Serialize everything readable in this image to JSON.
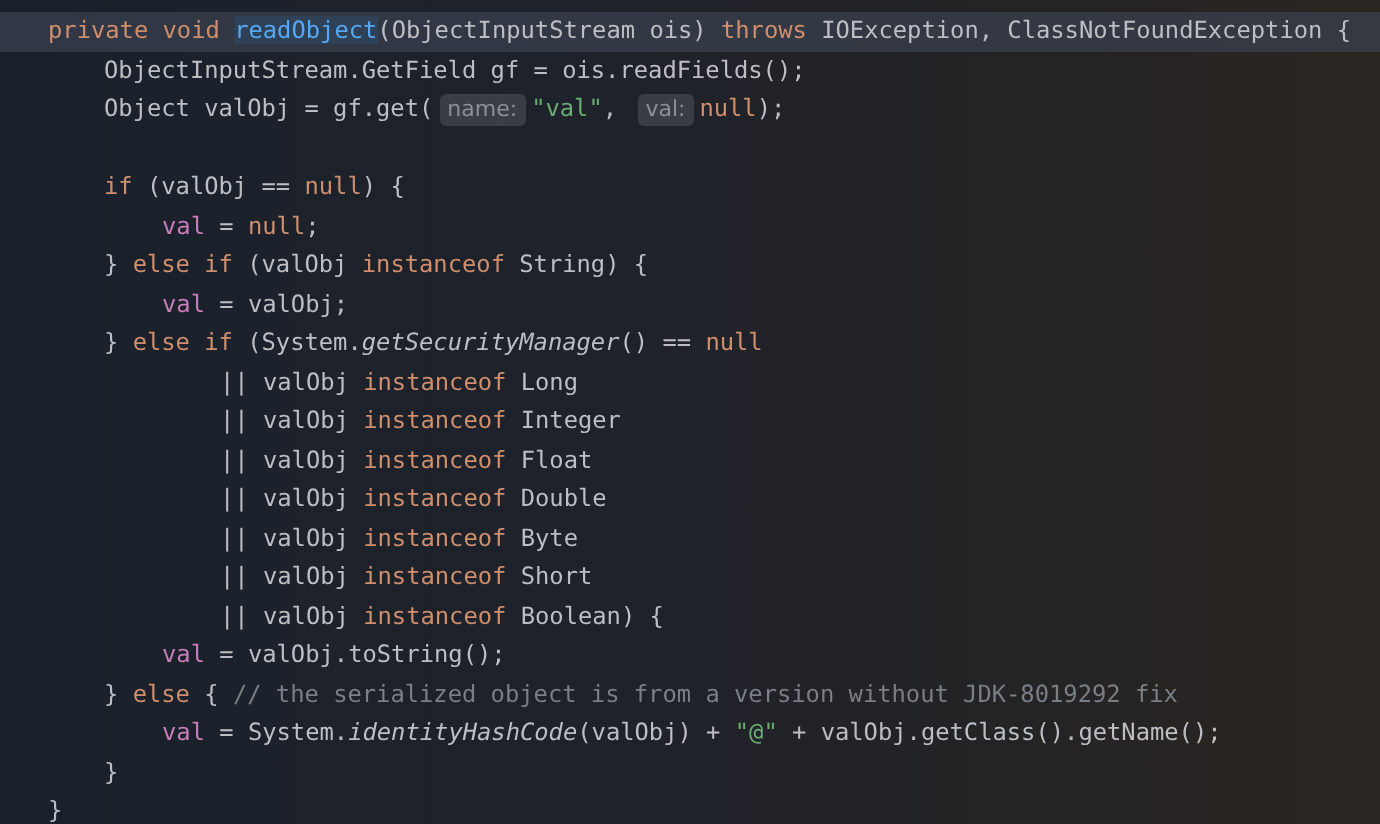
{
  "lines": [
    {
      "current": true,
      "kind": "outer",
      "tokens": [
        {
          "kind": "keyword",
          "text": "private void "
        },
        {
          "kind": "declaration",
          "text": "readObject"
        },
        {
          "kind": "plain",
          "text": "(ObjectInputStream ois) "
        },
        {
          "kind": "keyword",
          "text": "throws "
        },
        {
          "kind": "plain",
          "text": "IOException, ClassNotFoundException {"
        }
      ]
    },
    {
      "current": false,
      "kind": "body",
      "tokens": [
        {
          "kind": "plain",
          "text": "ObjectInputStream.GetField gf = ois.readFields();"
        }
      ]
    },
    {
      "current": false,
      "kind": "body",
      "tokens": [
        {
          "kind": "plain",
          "text": "Object valObj = gf.get("
        },
        {
          "kind": "hint",
          "text": "name:"
        },
        {
          "kind": "string",
          "text": "\"val\""
        },
        {
          "kind": "plain",
          "text": ", "
        },
        {
          "kind": "hint",
          "text": "val:"
        },
        {
          "kind": "keyword",
          "text": "null"
        },
        {
          "kind": "plain",
          "text": ");"
        }
      ]
    },
    {
      "current": false,
      "kind": "blank"
    },
    {
      "current": false,
      "kind": "body",
      "tokens": [
        {
          "kind": "keyword",
          "text": "if "
        },
        {
          "kind": "plain",
          "text": "(valObj == "
        },
        {
          "kind": "keyword",
          "text": "null"
        },
        {
          "kind": "plain",
          "text": ") {"
        }
      ]
    },
    {
      "current": false,
      "kind": "inner",
      "tokens": [
        {
          "kind": "field",
          "text": "val"
        },
        {
          "kind": "plain",
          "text": " = "
        },
        {
          "kind": "keyword",
          "text": "null"
        },
        {
          "kind": "plain",
          "text": ";"
        }
      ]
    },
    {
      "current": false,
      "kind": "body",
      "tokens": [
        {
          "kind": "plain",
          "text": "} "
        },
        {
          "kind": "keyword",
          "text": "else if "
        },
        {
          "kind": "plain",
          "text": "(valObj "
        },
        {
          "kind": "keyword",
          "text": "instanceof "
        },
        {
          "kind": "plain",
          "text": "String) {"
        }
      ]
    },
    {
      "current": false,
      "kind": "inner",
      "tokens": [
        {
          "kind": "field",
          "text": "val"
        },
        {
          "kind": "plain",
          "text": " = valObj;"
        }
      ]
    },
    {
      "current": false,
      "kind": "body",
      "tokens": [
        {
          "kind": "plain",
          "text": "} "
        },
        {
          "kind": "keyword",
          "text": "else if "
        },
        {
          "kind": "plain",
          "text": "(System."
        },
        {
          "kind": "static",
          "text": "getSecurityManager"
        },
        {
          "kind": "plain",
          "text": "() == "
        },
        {
          "kind": "keyword",
          "text": "null"
        }
      ]
    },
    {
      "current": false,
      "kind": "continued",
      "tokens": [
        {
          "kind": "plain",
          "text": "|| valObj "
        },
        {
          "kind": "keyword",
          "text": "instanceof "
        },
        {
          "kind": "plain",
          "text": "Long"
        }
      ]
    },
    {
      "current": false,
      "kind": "continued",
      "tokens": [
        {
          "kind": "plain",
          "text": "|| valObj "
        },
        {
          "kind": "keyword",
          "text": "instanceof "
        },
        {
          "kind": "plain",
          "text": "Integer"
        }
      ]
    },
    {
      "current": false,
      "kind": "continued",
      "tokens": [
        {
          "kind": "plain",
          "text": "|| valObj "
        },
        {
          "kind": "keyword",
          "text": "instanceof "
        },
        {
          "kind": "plain",
          "text": "Float"
        }
      ]
    },
    {
      "current": false,
      "kind": "continued",
      "tokens": [
        {
          "kind": "plain",
          "text": "|| valObj "
        },
        {
          "kind": "keyword",
          "text": "instanceof "
        },
        {
          "kind": "plain",
          "text": "Double"
        }
      ]
    },
    {
      "current": false,
      "kind": "continued",
      "tokens": [
        {
          "kind": "plain",
          "text": "|| valObj "
        },
        {
          "kind": "keyword",
          "text": "instanceof "
        },
        {
          "kind": "plain",
          "text": "Byte"
        }
      ]
    },
    {
      "current": false,
      "kind": "continued",
      "tokens": [
        {
          "kind": "plain",
          "text": "|| valObj "
        },
        {
          "kind": "keyword",
          "text": "instanceof "
        },
        {
          "kind": "plain",
          "text": "Short"
        }
      ]
    },
    {
      "current": false,
      "kind": "continued",
      "tokens": [
        {
          "kind": "plain",
          "text": "|| valObj "
        },
        {
          "kind": "keyword",
          "text": "instanceof "
        },
        {
          "kind": "plain",
          "text": "Boolean) {"
        }
      ]
    },
    {
      "current": false,
      "kind": "inner",
      "tokens": [
        {
          "kind": "field",
          "text": "val"
        },
        {
          "kind": "plain",
          "text": " = valObj.toString();"
        }
      ]
    },
    {
      "current": false,
      "kind": "body",
      "tokens": [
        {
          "kind": "plain",
          "text": "} "
        },
        {
          "kind": "keyword",
          "text": "else "
        },
        {
          "kind": "plain",
          "text": "{ "
        },
        {
          "kind": "comment",
          "text": "// the serialized object is from a version without JDK-8019292 fix"
        }
      ]
    },
    {
      "current": false,
      "kind": "inner",
      "tokens": [
        {
          "kind": "field",
          "text": "val"
        },
        {
          "kind": "plain",
          "text": " = System."
        },
        {
          "kind": "static",
          "text": "identityHashCode"
        },
        {
          "kind": "plain",
          "text": "(valObj) + "
        },
        {
          "kind": "string",
          "text": "\"@\""
        },
        {
          "kind": "plain",
          "text": " + valObj.getClass().getName();"
        }
      ]
    },
    {
      "current": false,
      "kind": "body",
      "tokens": [
        {
          "kind": "plain",
          "text": "}"
        }
      ]
    },
    {
      "current": false,
      "kind": "outer",
      "tokens": [
        {
          "kind": "plain",
          "text": "}"
        }
      ]
    }
  ]
}
